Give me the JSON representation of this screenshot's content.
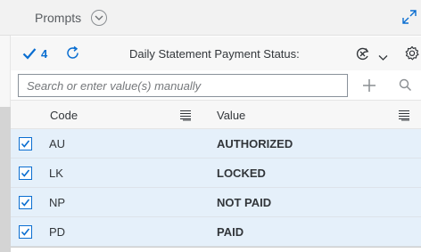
{
  "header": {
    "title": "Prompts",
    "toggle_icon": "chevron-down-circle-icon",
    "expand_icon": "expand-icon"
  },
  "toolbar": {
    "selected_count": "4",
    "title": "Daily Statement Payment Status:",
    "icons": [
      "checkmark-icon",
      "refresh-icon",
      "clear-filter-icon",
      "chevron-down-icon",
      "settings-icon"
    ]
  },
  "search": {
    "placeholder": "Search or enter value(s) manually",
    "value": ""
  },
  "table": {
    "columns": [
      {
        "label": "Code"
      },
      {
        "label": "Value"
      }
    ],
    "rows": [
      {
        "code": "AU",
        "value": "AUTHORIZED",
        "checked": true
      },
      {
        "code": "LK",
        "value": "LOCKED",
        "checked": true
      },
      {
        "code": "NP",
        "value": "NOT PAID",
        "checked": true
      },
      {
        "code": "PD",
        "value": "PAID",
        "checked": true
      }
    ]
  },
  "colors": {
    "accent": "#0a6ed1",
    "selected_row": "#e5f0fa",
    "header_bg": "#f2f2f2"
  }
}
